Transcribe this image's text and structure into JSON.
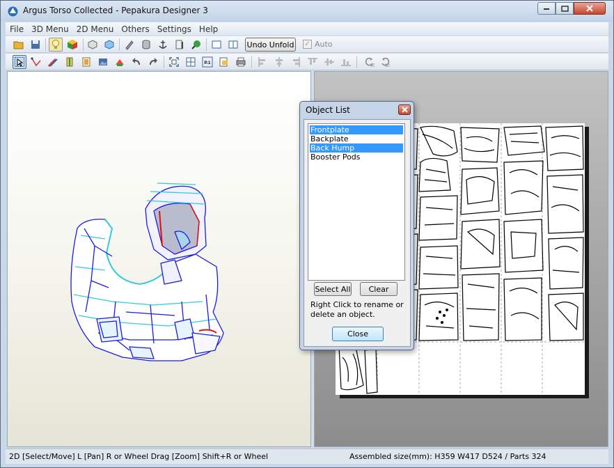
{
  "window": {
    "title": "Argus Torso Collected - Pepakura Designer 3",
    "controls": [
      "minimize",
      "maximize",
      "close"
    ]
  },
  "menubar": {
    "items": [
      "File",
      "3D Menu",
      "2D Menu",
      "Others",
      "Settings",
      "Help"
    ]
  },
  "toolbar1": {
    "undo_label": "Undo Unfold",
    "auto_label": "Auto",
    "auto_checked": true,
    "auto_enabled": false,
    "icons": [
      "open-icon",
      "save-icon",
      "light-icon",
      "texture-icon",
      "3d-box-icon",
      "3d-texture-icon",
      "pencil-icon",
      "cylinder-icon",
      "anchor-icon",
      "edit-icon",
      "globe-icon",
      "single-view-icon",
      "dual-view-icon"
    ]
  },
  "toolbar2": {
    "icons": [
      "select-icon",
      "join-icon",
      "brush-icon",
      "fold-icon",
      "flap-icon",
      "image-icon",
      "flip-icon",
      "undo-arrow-icon",
      "redo-arrow-icon",
      "zoom-fit-icon",
      "grid-icon",
      "page-icon",
      "print-preview-icon",
      "print-icon",
      "align-left-icon",
      "align-center-icon",
      "align-right-icon",
      "align-top-icon",
      "align-middle-icon",
      "align-bottom-icon",
      "rotate-90-left-icon",
      "rotate-90-right-icon"
    ],
    "page_label": "P.1",
    "rotate_left_label": "90",
    "rotate_right_label": "90"
  },
  "dialog": {
    "title": "Object List",
    "objects": [
      {
        "name": "Frontplate",
        "selected": true
      },
      {
        "name": "Backplate",
        "selected": false
      },
      {
        "name": "Back Hump",
        "selected": true
      },
      {
        "name": "Booster Pods",
        "selected": false
      }
    ],
    "select_all": "Select All",
    "clear": "Clear",
    "hint": "Right Click to rename or delete an object.",
    "close": "Close"
  },
  "status": {
    "left": "2D [Select/Move] L [Pan] R or Wheel Drag [Zoom] Shift+R or Wheel",
    "right": "Assembled size(mm): H359 W417 D524 / Parts 324"
  },
  "colors": {
    "selection": "#3399ff",
    "model_edge": "#1a1ae6",
    "model_highlight": "#33ccdd",
    "model_red": "#dd1111",
    "pane_2d_bg": "#a6a6a6"
  }
}
